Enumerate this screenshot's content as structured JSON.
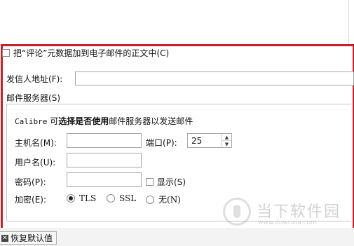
{
  "attach_comments": {
    "label": "把“评论”元数据加到电子邮件的正文中",
    "shortcut": "C",
    "checked": false
  },
  "sender": {
    "label": "发信人地址",
    "shortcut": "F",
    "value": ""
  },
  "server_section": {
    "label": "邮件服务器",
    "shortcut": "S"
  },
  "server_hint": {
    "prefix": "Calibre",
    "mid1": "可",
    "bold": "选择是否使用",
    "rest": "邮件服务器以发送邮件"
  },
  "hostname": {
    "label": "主机名",
    "shortcut": "M",
    "value": ""
  },
  "port": {
    "label": "端口",
    "shortcut": "P",
    "value": "25"
  },
  "username": {
    "label": "用户名",
    "shortcut": "U",
    "value": ""
  },
  "password": {
    "label": "密码",
    "shortcut": "P",
    "value": ""
  },
  "show_password": {
    "label": "显示",
    "shortcut": "S",
    "checked": false
  },
  "encryption": {
    "label": "加密",
    "shortcut": "E",
    "options": [
      {
        "label": "TLS",
        "checked": true
      },
      {
        "label": "SSL",
        "checked": false
      },
      {
        "label": "无",
        "shortcut": "N",
        "checked": false
      }
    ]
  },
  "restore_defaults": {
    "label": "恢复默认值"
  },
  "watermark": {
    "text": "当下软件园",
    "url": "www.downxia.com"
  }
}
